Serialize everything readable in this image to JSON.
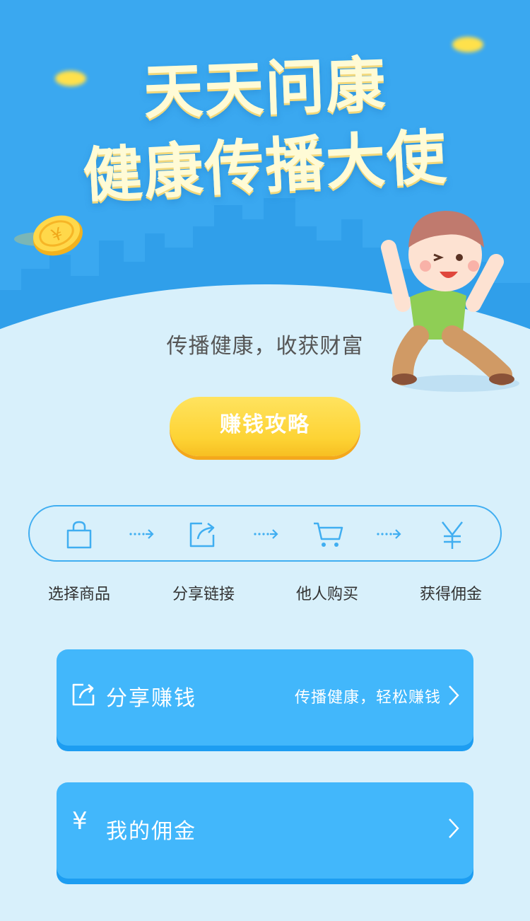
{
  "hero": {
    "title_line1": "天天问康",
    "title_line2": "健康传播大使",
    "subtitle": "传播健康，收获财富"
  },
  "cta": {
    "label": "赚钱攻略"
  },
  "steps": [
    {
      "label": "选择商品",
      "icon": "shopping-bag-icon"
    },
    {
      "label": "分享链接",
      "icon": "share-icon"
    },
    {
      "label": "他人购买",
      "icon": "cart-icon"
    },
    {
      "label": "获得佣金",
      "icon": "yen-icon"
    }
  ],
  "cards": [
    {
      "title": "分享赚钱",
      "desc": "传播健康，轻松赚钱",
      "icon": "share-icon"
    },
    {
      "title": "我的佣金",
      "desc": "",
      "icon": "yen-icon",
      "icon_text": "¥"
    }
  ],
  "colors": {
    "hero_blue": "#3aa8f0",
    "page_bg": "#d8f0fb",
    "card_blue": "#42b7fb",
    "cta_yellow": "#fdd334",
    "step_border": "#40aef1"
  }
}
